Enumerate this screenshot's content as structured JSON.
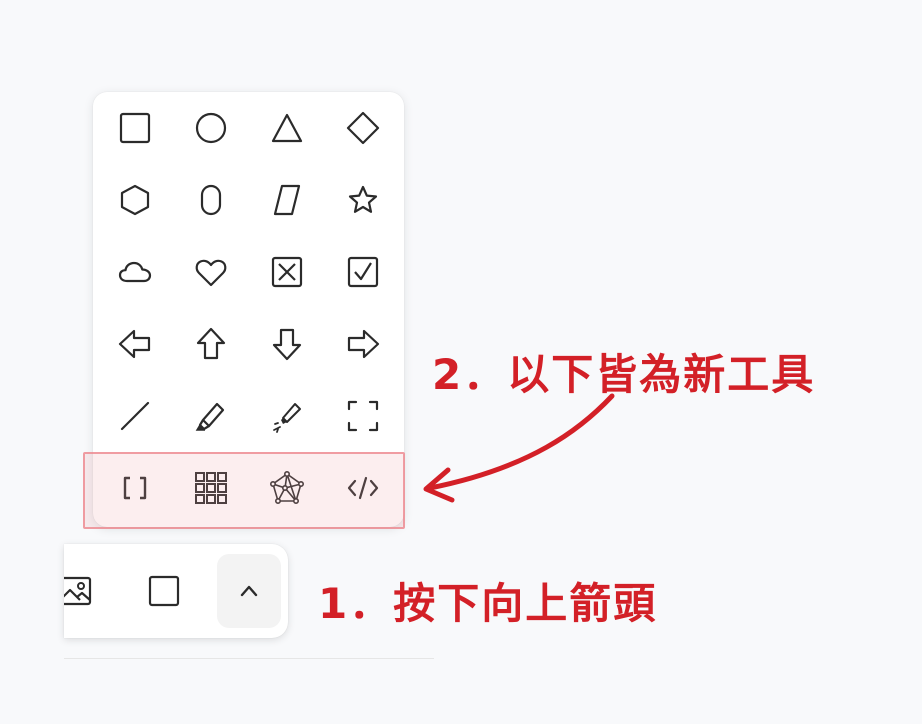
{
  "annotations": {
    "step1": "1．按下向上箭頭",
    "step2": "2．以下皆為新工具"
  },
  "palette": {
    "tools": [
      {
        "name": "rectangle-icon"
      },
      {
        "name": "ellipse-icon"
      },
      {
        "name": "triangle-icon"
      },
      {
        "name": "diamond-icon"
      },
      {
        "name": "hexagon-icon"
      },
      {
        "name": "pill-icon"
      },
      {
        "name": "parallelogram-icon"
      },
      {
        "name": "star-icon"
      },
      {
        "name": "cloud-icon"
      },
      {
        "name": "heart-icon"
      },
      {
        "name": "x-box-icon"
      },
      {
        "name": "check-box-icon"
      },
      {
        "name": "arrow-left-icon"
      },
      {
        "name": "arrow-up-icon"
      },
      {
        "name": "arrow-down-icon"
      },
      {
        "name": "arrow-right-icon"
      },
      {
        "name": "line-icon"
      },
      {
        "name": "highlighter-icon"
      },
      {
        "name": "laser-pointer-icon"
      },
      {
        "name": "frame-icon"
      },
      {
        "name": "brackets-icon"
      },
      {
        "name": "grid-icon"
      },
      {
        "name": "network-icon"
      },
      {
        "name": "code-icon"
      }
    ]
  },
  "toolbar": {
    "buttons": [
      {
        "name": "image-tool-button",
        "icon": "image-icon"
      },
      {
        "name": "rectangle-tool-button",
        "icon": "rectangle-icon"
      },
      {
        "name": "more-tools-button",
        "icon": "chevron-up-icon",
        "active": true
      }
    ]
  },
  "colors": {
    "annotation": "#d32027",
    "icon": "#2b2b2b",
    "highlight_border": "#ec8088"
  }
}
